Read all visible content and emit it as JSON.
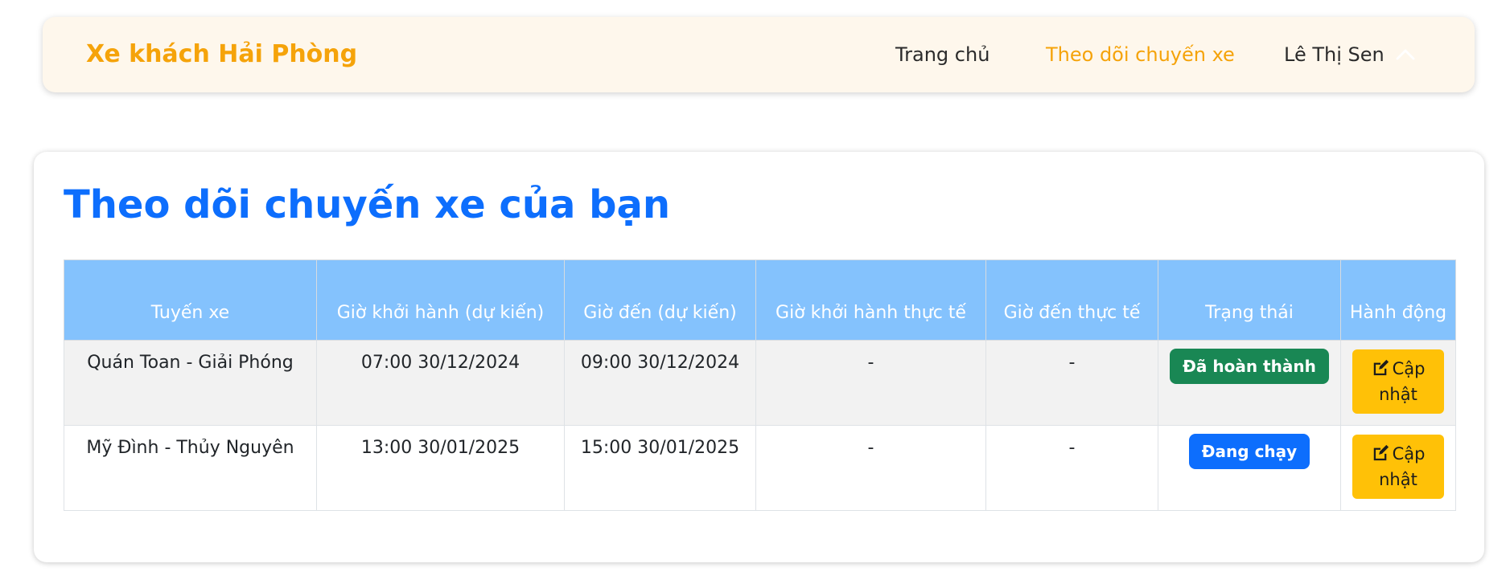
{
  "navbar": {
    "brand": "Xe khách Hải Phòng",
    "links": [
      {
        "label": "Trang chủ",
        "active": false
      },
      {
        "label": "Theo dõi chuyến xe",
        "active": true
      }
    ],
    "user_name": "Lê Thị Sen",
    "user_menu_icon": "chevron-up-icon"
  },
  "main": {
    "title": "Theo dõi chuyến xe của bạn",
    "table": {
      "headers": [
        "Tuyến xe",
        "Giờ khởi hành (dự kiến)",
        "Giờ đến (dự kiến)",
        "Giờ khởi hành thực tế",
        "Giờ đến thực tế",
        "Trạng thái",
        "Hành động"
      ],
      "rows": [
        {
          "route": "Quán Toan - Giải Phóng",
          "planned_departure": "07:00 30/12/2024",
          "planned_arrival": "09:00 30/12/2024",
          "actual_departure": "-",
          "actual_arrival": "-",
          "status": "Đã hoàn thành",
          "status_color": "#198754",
          "action_label": "Cập nhật",
          "action_icon": "edit-icon"
        },
        {
          "route": "Mỹ Đình - Thủy Nguyên",
          "planned_departure": "13:00 30/01/2025",
          "planned_arrival": "15:00 30/01/2025",
          "actual_departure": "-",
          "actual_arrival": "-",
          "status": "Đang chạy",
          "status_color": "#0d6efd",
          "action_label": "Cập nhật",
          "action_icon": "edit-icon"
        }
      ]
    }
  },
  "colors": {
    "brand": "#f5a30a",
    "navbar_bg": "#fef7ec",
    "title": "#0d6efd",
    "table_header_bg": "#84c2fd",
    "action_button": "#ffc107"
  }
}
